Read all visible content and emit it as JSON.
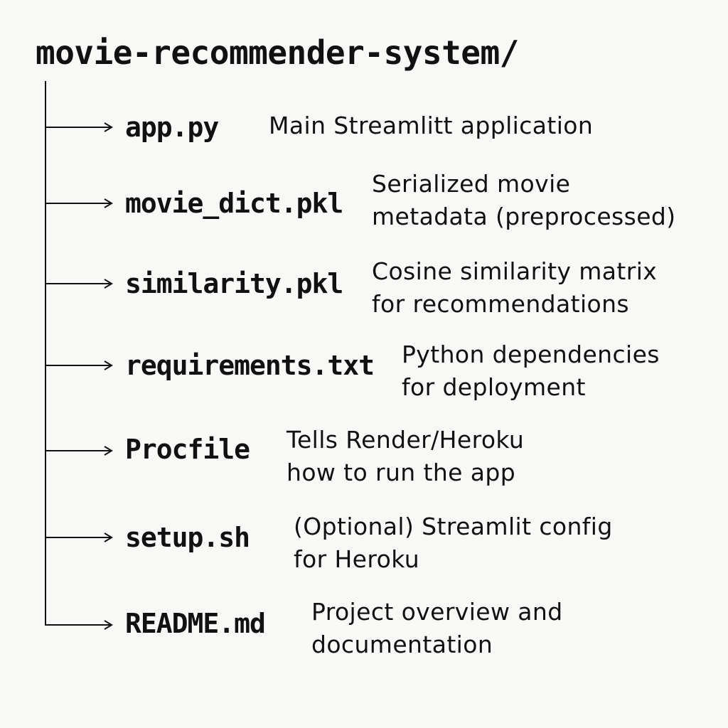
{
  "root": {
    "name": "movie-recommender-system/"
  },
  "entries": [
    {
      "file": "app.py",
      "description": "Main Streamlitt application"
    },
    {
      "file": "movie_dict.pkl",
      "description": "Serialized movie\nmetadata (preprocessed)"
    },
    {
      "file": "similarity.pkl",
      "description": "Cosine similarity matrix\nfor recommendations"
    },
    {
      "file": "requirements.txt",
      "description": "Python dependencies\nfor deployment"
    },
    {
      "file": "Procfile",
      "description": "Tells Render/Heroku\nhow to run the app"
    },
    {
      "file": "setup.sh",
      "description": "(Optional) Streamlit config\nfor Heroku"
    },
    {
      "file": "README.md",
      "description": "Project overview and\ndocumentation"
    }
  ],
  "colors": {
    "background": "#f8f8f6",
    "ink": "#111111"
  }
}
